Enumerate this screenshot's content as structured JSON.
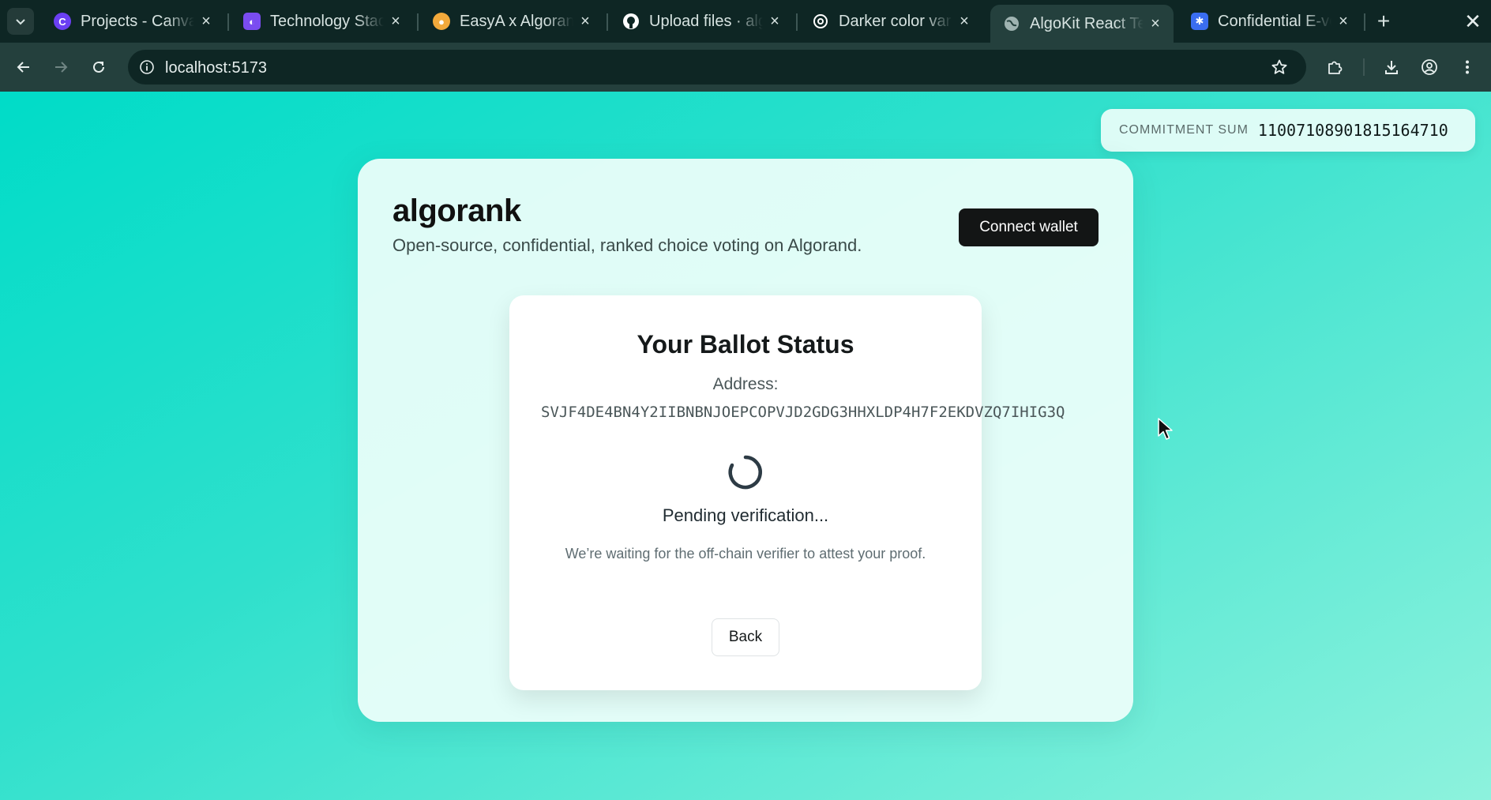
{
  "browser": {
    "tabs": [
      {
        "title": "Projects - Canva",
        "icon": "canva-icon",
        "color": "#6b3ff2",
        "active": false
      },
      {
        "title": "Technology Stack",
        "icon": "app-icon",
        "color": "#7a4cf0",
        "active": false
      },
      {
        "title": "EasyA x Algorand",
        "icon": "user-icon",
        "color": "#f2a93b",
        "active": false
      },
      {
        "title": "Upload files · algorank",
        "icon": "github-icon",
        "color": "#ffffff",
        "active": false
      },
      {
        "title": "Darker color variant",
        "icon": "openai-icon",
        "color": "#ffffff",
        "active": false
      },
      {
        "title": "AlgoKit React Template",
        "icon": "globe-icon",
        "color": "#9fb3b1",
        "active": true
      },
      {
        "title": "Confidential E-voting",
        "icon": "app-icon",
        "color": "#3a6df0",
        "active": false
      }
    ],
    "url": "localhost:5173"
  },
  "commitment": {
    "label": "COMMITMENT SUM",
    "value": "11007108901815164710"
  },
  "app": {
    "title": "algorank",
    "subtitle": "Open-source, confidential, ranked choice voting on Algorand.",
    "connect_label": "Connect wallet"
  },
  "ballot": {
    "title": "Your Ballot Status",
    "address_label": "Address:",
    "address": "SVJF4DE4BN4Y2IIBNBNJOEPCOPVJD2GDG3HHXLDP4H7F2EKDVZQ7IHIG3Q",
    "status": "Pending verification...",
    "message": "We’re waiting for the off-chain verifier to attest your proof.",
    "back_label": "Back"
  },
  "colors": {
    "accent": "#00dcc8",
    "button_dark": "#131515",
    "chrome": "#0e2624"
  }
}
